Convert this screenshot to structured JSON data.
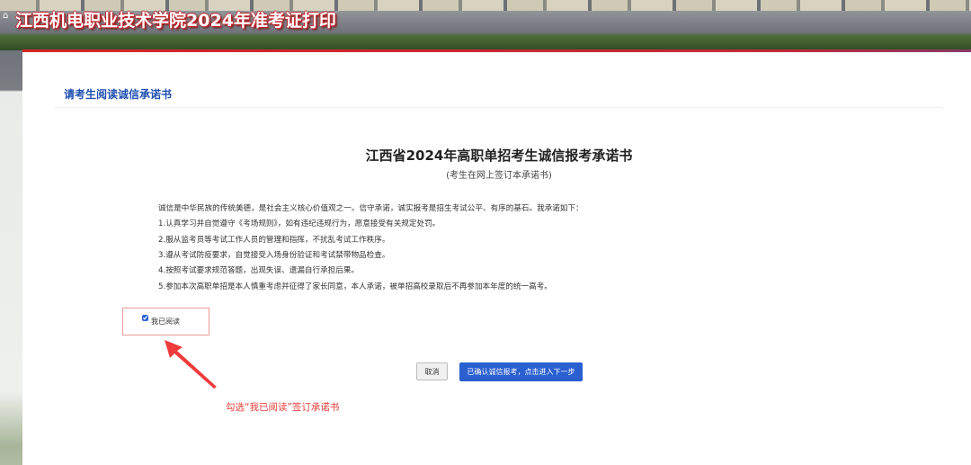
{
  "header": {
    "title": "江西机电职业技术学院2024年准考证打印",
    "home_icon": "home-icon"
  },
  "section": {
    "title": "请考生阅读诚信承诺书"
  },
  "letter": {
    "title": "江西省2024年高职单招考生诚信报考承诺书",
    "subtitle": "(考生在网上签订本承诺书)",
    "lines": [
      "诚信是中华民族的传统美德，是社会主义核心价值观之一。信守承诺，诚实报考是招生考试公平、有序的基石。我承诺如下：",
      "1.认真学习并自觉遵守《考场规则》，如有违纪违规行为，愿意接受有关规定处罚。",
      "2.服从监考员等考试工作人员的管理和指挥，不扰乱考试工作秩序。",
      "3.遵从考试防疫要求，自觉接受入场身份验证和考试禁带物品检查。",
      "4.按照考试要求规范答题，出现失误、遗漏自行承担后果。",
      "5.参加本次高职单招是本人慎重考虑并征得了家长同意，本人承诺，被单招高校录取后不再参加本年度的统一高考。"
    ]
  },
  "agree": {
    "label": "我已阅读",
    "checked": true
  },
  "buttons": {
    "cancel": "取消",
    "confirm": "已确认诚信报考，点击进入下一步"
  },
  "annotation": {
    "text": "勾选“我已阅读”签订承诺书",
    "color": "#e53935"
  },
  "colors": {
    "accent": "#2a5fd0",
    "section_title": "#1f4fb0",
    "header_stripe": "#d8262a"
  }
}
